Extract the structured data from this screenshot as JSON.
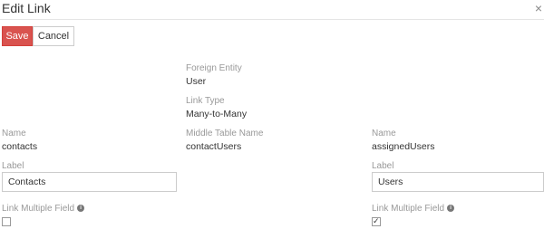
{
  "dialog": {
    "title": "Edit Link",
    "close_glyph": "×"
  },
  "toolbar": {
    "save_label": "Save",
    "cancel_label": "Cancel"
  },
  "center": {
    "foreign_entity_label": "Foreign Entity",
    "foreign_entity_value": "User",
    "link_type_label": "Link Type",
    "link_type_value": "Many-to-Many",
    "middle_table_label": "Middle Table Name",
    "middle_table_value": "contactUsers"
  },
  "left": {
    "name_label": "Name",
    "name_value": "contacts",
    "label_label": "Label",
    "label_value": "Contacts",
    "link_multiple_label": "Link Multiple Field",
    "link_multiple_checked": false
  },
  "right": {
    "name_label": "Name",
    "name_value": "assignedUsers",
    "label_label": "Label",
    "label_value": "Users",
    "link_multiple_label": "Link Multiple Field",
    "link_multiple_checked": true
  },
  "icons": {
    "info": "info-circle-icon",
    "close": "close-icon",
    "check": "check-icon"
  },
  "colors": {
    "save_button": "#d9534f",
    "label_gray": "#999999"
  }
}
